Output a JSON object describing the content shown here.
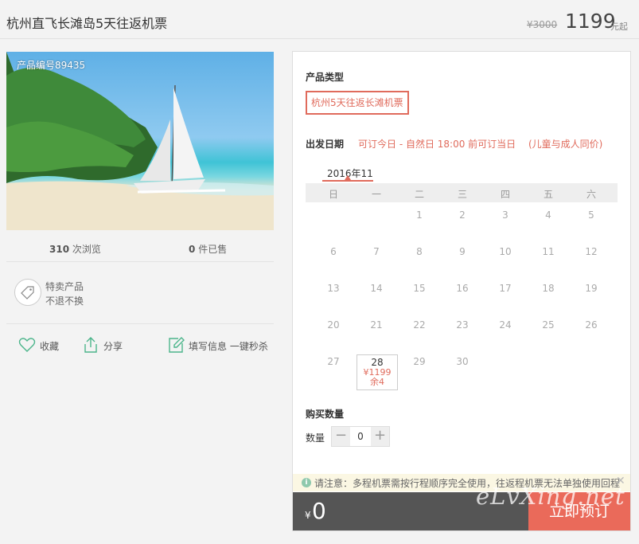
{
  "header": {
    "title": "杭州直飞长滩岛5天往返机票",
    "original_price": "¥3000",
    "price": "1199",
    "price_unit": "元起"
  },
  "gallery": {
    "product_no": "产品编号89435"
  },
  "stats": {
    "views_count": "310",
    "views_label": "次浏览",
    "sold_count": "0",
    "sold_label": "件已售"
  },
  "special": {
    "line1": "特卖产品",
    "line2": "不退不换"
  },
  "actions": {
    "favorite": "收藏",
    "share": "分享",
    "fill_info": "填写信息 一键秒杀"
  },
  "booking": {
    "type_title": "产品类型",
    "type_option": "杭州5天往返长滩机票",
    "date_title": "出发日期",
    "date_hint": "可订今日 - 自然日 18:00 前可订当日",
    "date_note": "(儿童与成人同价)",
    "month": "2016年11",
    "weekdays": [
      "日",
      "一",
      "二",
      "三",
      "四",
      "五",
      "六"
    ],
    "days": [
      "1",
      "2",
      "3",
      "4",
      "5",
      "6",
      "7",
      "8",
      "9",
      "10",
      "11",
      "12",
      "13",
      "14",
      "15",
      "16",
      "17",
      "18",
      "19",
      "20",
      "21",
      "22",
      "23",
      "24",
      "25",
      "26",
      "27",
      "28",
      "29",
      "30"
    ],
    "selected_day": {
      "day": "28",
      "price": "¥1199",
      "stock": "余4"
    },
    "quantity_title": "购买数量",
    "quantity_label": "数量",
    "quantity_value": "0",
    "minus": "−",
    "plus": "+",
    "notice": "请注意：多程机票需按行程顺序完全使用，往返程机票无法单独使用回程",
    "notice_icon": "i",
    "notice_close": "✕",
    "total_currency": "¥",
    "total_value": "0",
    "book_button": "立即预订"
  },
  "watermark": "eLvXing.net",
  "colors": {
    "accent": "#e06b5c",
    "book_button": "#ea6a5a",
    "footer": "#555555"
  }
}
